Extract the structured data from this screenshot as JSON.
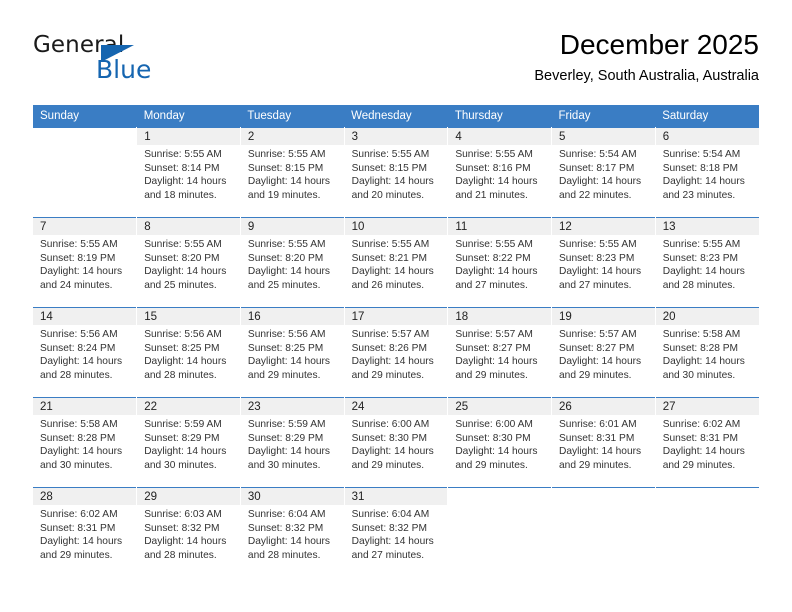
{
  "brand": {
    "name_part1": "General",
    "name_part2": "Blue",
    "triangle_color": "#1565b0"
  },
  "header": {
    "title": "December 2025",
    "subtitle": "Beverley, South Australia, Australia"
  },
  "theme": {
    "header_bar_color": "#3a7dc4",
    "daynum_band_color": "#f0f0f0",
    "text_color": "#333333"
  },
  "weekdays": [
    "Sunday",
    "Monday",
    "Tuesday",
    "Wednesday",
    "Thursday",
    "Friday",
    "Saturday"
  ],
  "labels": {
    "sunrise_prefix": "Sunrise:",
    "sunset_prefix": "Sunset:",
    "daylight_prefix": "Daylight:"
  },
  "weeks": [
    [
      {
        "day": "",
        "sunrise": "",
        "sunset": "",
        "daylight_line1": "",
        "daylight_line2": "",
        "empty": true
      },
      {
        "day": "1",
        "sunrise": "Sunrise: 5:55 AM",
        "sunset": "Sunset: 8:14 PM",
        "daylight_line1": "Daylight: 14 hours",
        "daylight_line2": "and 18 minutes."
      },
      {
        "day": "2",
        "sunrise": "Sunrise: 5:55 AM",
        "sunset": "Sunset: 8:15 PM",
        "daylight_line1": "Daylight: 14 hours",
        "daylight_line2": "and 19 minutes."
      },
      {
        "day": "3",
        "sunrise": "Sunrise: 5:55 AM",
        "sunset": "Sunset: 8:15 PM",
        "daylight_line1": "Daylight: 14 hours",
        "daylight_line2": "and 20 minutes."
      },
      {
        "day": "4",
        "sunrise": "Sunrise: 5:55 AM",
        "sunset": "Sunset: 8:16 PM",
        "daylight_line1": "Daylight: 14 hours",
        "daylight_line2": "and 21 minutes."
      },
      {
        "day": "5",
        "sunrise": "Sunrise: 5:54 AM",
        "sunset": "Sunset: 8:17 PM",
        "daylight_line1": "Daylight: 14 hours",
        "daylight_line2": "and 22 minutes."
      },
      {
        "day": "6",
        "sunrise": "Sunrise: 5:54 AM",
        "sunset": "Sunset: 8:18 PM",
        "daylight_line1": "Daylight: 14 hours",
        "daylight_line2": "and 23 minutes."
      }
    ],
    [
      {
        "day": "7",
        "sunrise": "Sunrise: 5:55 AM",
        "sunset": "Sunset: 8:19 PM",
        "daylight_line1": "Daylight: 14 hours",
        "daylight_line2": "and 24 minutes."
      },
      {
        "day": "8",
        "sunrise": "Sunrise: 5:55 AM",
        "sunset": "Sunset: 8:20 PM",
        "daylight_line1": "Daylight: 14 hours",
        "daylight_line2": "and 25 minutes."
      },
      {
        "day": "9",
        "sunrise": "Sunrise: 5:55 AM",
        "sunset": "Sunset: 8:20 PM",
        "daylight_line1": "Daylight: 14 hours",
        "daylight_line2": "and 25 minutes."
      },
      {
        "day": "10",
        "sunrise": "Sunrise: 5:55 AM",
        "sunset": "Sunset: 8:21 PM",
        "daylight_line1": "Daylight: 14 hours",
        "daylight_line2": "and 26 minutes."
      },
      {
        "day": "11",
        "sunrise": "Sunrise: 5:55 AM",
        "sunset": "Sunset: 8:22 PM",
        "daylight_line1": "Daylight: 14 hours",
        "daylight_line2": "and 27 minutes."
      },
      {
        "day": "12",
        "sunrise": "Sunrise: 5:55 AM",
        "sunset": "Sunset: 8:23 PM",
        "daylight_line1": "Daylight: 14 hours",
        "daylight_line2": "and 27 minutes."
      },
      {
        "day": "13",
        "sunrise": "Sunrise: 5:55 AM",
        "sunset": "Sunset: 8:23 PM",
        "daylight_line1": "Daylight: 14 hours",
        "daylight_line2": "and 28 minutes."
      }
    ],
    [
      {
        "day": "14",
        "sunrise": "Sunrise: 5:56 AM",
        "sunset": "Sunset: 8:24 PM",
        "daylight_line1": "Daylight: 14 hours",
        "daylight_line2": "and 28 minutes."
      },
      {
        "day": "15",
        "sunrise": "Sunrise: 5:56 AM",
        "sunset": "Sunset: 8:25 PM",
        "daylight_line1": "Daylight: 14 hours",
        "daylight_line2": "and 28 minutes."
      },
      {
        "day": "16",
        "sunrise": "Sunrise: 5:56 AM",
        "sunset": "Sunset: 8:25 PM",
        "daylight_line1": "Daylight: 14 hours",
        "daylight_line2": "and 29 minutes."
      },
      {
        "day": "17",
        "sunrise": "Sunrise: 5:57 AM",
        "sunset": "Sunset: 8:26 PM",
        "daylight_line1": "Daylight: 14 hours",
        "daylight_line2": "and 29 minutes."
      },
      {
        "day": "18",
        "sunrise": "Sunrise: 5:57 AM",
        "sunset": "Sunset: 8:27 PM",
        "daylight_line1": "Daylight: 14 hours",
        "daylight_line2": "and 29 minutes."
      },
      {
        "day": "19",
        "sunrise": "Sunrise: 5:57 AM",
        "sunset": "Sunset: 8:27 PM",
        "daylight_line1": "Daylight: 14 hours",
        "daylight_line2": "and 29 minutes."
      },
      {
        "day": "20",
        "sunrise": "Sunrise: 5:58 AM",
        "sunset": "Sunset: 8:28 PM",
        "daylight_line1": "Daylight: 14 hours",
        "daylight_line2": "and 30 minutes."
      }
    ],
    [
      {
        "day": "21",
        "sunrise": "Sunrise: 5:58 AM",
        "sunset": "Sunset: 8:28 PM",
        "daylight_line1": "Daylight: 14 hours",
        "daylight_line2": "and 30 minutes."
      },
      {
        "day": "22",
        "sunrise": "Sunrise: 5:59 AM",
        "sunset": "Sunset: 8:29 PM",
        "daylight_line1": "Daylight: 14 hours",
        "daylight_line2": "and 30 minutes."
      },
      {
        "day": "23",
        "sunrise": "Sunrise: 5:59 AM",
        "sunset": "Sunset: 8:29 PM",
        "daylight_line1": "Daylight: 14 hours",
        "daylight_line2": "and 30 minutes."
      },
      {
        "day": "24",
        "sunrise": "Sunrise: 6:00 AM",
        "sunset": "Sunset: 8:30 PM",
        "daylight_line1": "Daylight: 14 hours",
        "daylight_line2": "and 29 minutes."
      },
      {
        "day": "25",
        "sunrise": "Sunrise: 6:00 AM",
        "sunset": "Sunset: 8:30 PM",
        "daylight_line1": "Daylight: 14 hours",
        "daylight_line2": "and 29 minutes."
      },
      {
        "day": "26",
        "sunrise": "Sunrise: 6:01 AM",
        "sunset": "Sunset: 8:31 PM",
        "daylight_line1": "Daylight: 14 hours",
        "daylight_line2": "and 29 minutes."
      },
      {
        "day": "27",
        "sunrise": "Sunrise: 6:02 AM",
        "sunset": "Sunset: 8:31 PM",
        "daylight_line1": "Daylight: 14 hours",
        "daylight_line2": "and 29 minutes."
      }
    ],
    [
      {
        "day": "28",
        "sunrise": "Sunrise: 6:02 AM",
        "sunset": "Sunset: 8:31 PM",
        "daylight_line1": "Daylight: 14 hours",
        "daylight_line2": "and 29 minutes."
      },
      {
        "day": "29",
        "sunrise": "Sunrise: 6:03 AM",
        "sunset": "Sunset: 8:32 PM",
        "daylight_line1": "Daylight: 14 hours",
        "daylight_line2": "and 28 minutes."
      },
      {
        "day": "30",
        "sunrise": "Sunrise: 6:04 AM",
        "sunset": "Sunset: 8:32 PM",
        "daylight_line1": "Daylight: 14 hours",
        "daylight_line2": "and 28 minutes."
      },
      {
        "day": "31",
        "sunrise": "Sunrise: 6:04 AM",
        "sunset": "Sunset: 8:32 PM",
        "daylight_line1": "Daylight: 14 hours",
        "daylight_line2": "and 27 minutes."
      },
      {
        "day": "",
        "sunrise": "",
        "sunset": "",
        "daylight_line1": "",
        "daylight_line2": "",
        "empty": true
      },
      {
        "day": "",
        "sunrise": "",
        "sunset": "",
        "daylight_line1": "",
        "daylight_line2": "",
        "empty": true
      },
      {
        "day": "",
        "sunrise": "",
        "sunset": "",
        "daylight_line1": "",
        "daylight_line2": "",
        "empty": true
      }
    ]
  ]
}
